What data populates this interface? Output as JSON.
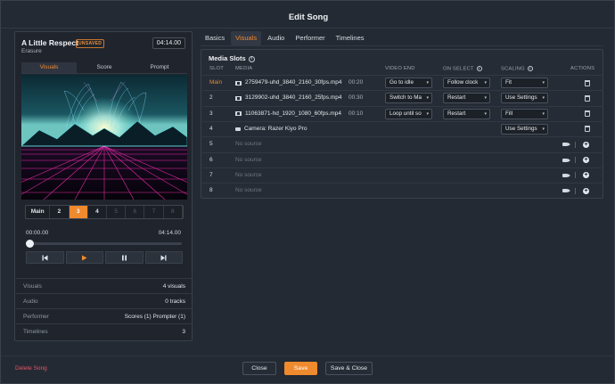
{
  "window": {
    "title": "Edit Song"
  },
  "song": {
    "title": "A Little Respect",
    "status_badge": "UNSAVED",
    "artist": "Erasure",
    "duration": "04:14.00"
  },
  "left_tabs": [
    {
      "label": "Visuals",
      "active": true
    },
    {
      "label": "Score",
      "active": false
    },
    {
      "label": "Prompt",
      "active": false
    }
  ],
  "slot_buttons": [
    {
      "label": "Main",
      "state": "normal"
    },
    {
      "label": "2",
      "state": "normal"
    },
    {
      "label": "3",
      "state": "active"
    },
    {
      "label": "4",
      "state": "normal"
    },
    {
      "label": "5",
      "state": "dim"
    },
    {
      "label": "6",
      "state": "dim"
    },
    {
      "label": "7",
      "state": "dim"
    },
    {
      "label": "8",
      "state": "dim"
    }
  ],
  "player": {
    "current_time": "00:00.00",
    "total_time": "04:14.00",
    "progress": 0,
    "controls": [
      "skip-back-icon",
      "play-icon",
      "pause-icon",
      "skip-forward-icon"
    ]
  },
  "stats": [
    {
      "key": "Visuals",
      "value": "4 visuals"
    },
    {
      "key": "Audio",
      "value": "0 tracks"
    },
    {
      "key": "Performer",
      "value": "Scores (1)   Prompter (1)"
    },
    {
      "key": "Timelines",
      "value": "3"
    }
  ],
  "tabs": [
    {
      "label": "Basics",
      "active": false
    },
    {
      "label": "Visuals",
      "active": true
    },
    {
      "label": "Audio",
      "active": false
    },
    {
      "label": "Performer",
      "active": false
    },
    {
      "label": "Timelines",
      "active": false
    }
  ],
  "media_slots": {
    "title": "Media Slots",
    "headers": {
      "slot": "SLOT",
      "media": "MEDIA",
      "video_end": "VIDEO END",
      "on_select": "ON SELECT",
      "scaling": "SCALING",
      "actions": "ACTIONS"
    },
    "rows": [
      {
        "slot": "Main",
        "media": "2759479-uhd_3840_2160_30fps.mp4",
        "type": "film",
        "duration": "00:20",
        "video_end": "Go to idle",
        "on_select": "Follow clock",
        "scaling": "Fit",
        "action": "trash"
      },
      {
        "slot": "2",
        "media": "3129902-uhd_3840_2160_25fps.mp4",
        "type": "film",
        "duration": "00:30",
        "video_end": "Switch to Ma",
        "on_select": "Restart",
        "scaling": "Use Settings",
        "action": "trash"
      },
      {
        "slot": "3",
        "media": "11063871-hd_1920_1080_60fps.mp4",
        "type": "film",
        "duration": "00:10",
        "video_end": "Loop until so",
        "on_select": "Restart",
        "scaling": "Fill",
        "action": "trash"
      },
      {
        "slot": "4",
        "media": "Camera: Razer Kiyo Pro",
        "type": "camera",
        "duration": "",
        "video_end": "",
        "on_select": "",
        "scaling": "Use Settings",
        "action": "trash"
      },
      {
        "slot": "5",
        "media": "No source",
        "type": "empty",
        "action": "add"
      },
      {
        "slot": "6",
        "media": "No source",
        "type": "empty",
        "action": "add"
      },
      {
        "slot": "7",
        "media": "No source",
        "type": "empty",
        "action": "add"
      },
      {
        "slot": "8",
        "media": "No source",
        "type": "empty",
        "action": "add"
      }
    ]
  },
  "footer": {
    "delete_label": "Delete Song",
    "close_label": "Close",
    "save_label": "Save",
    "save_close_label": "Save & Close"
  },
  "colors": {
    "accent": "#f08a2e",
    "danger": "#e0576b",
    "background": "#242a33"
  }
}
